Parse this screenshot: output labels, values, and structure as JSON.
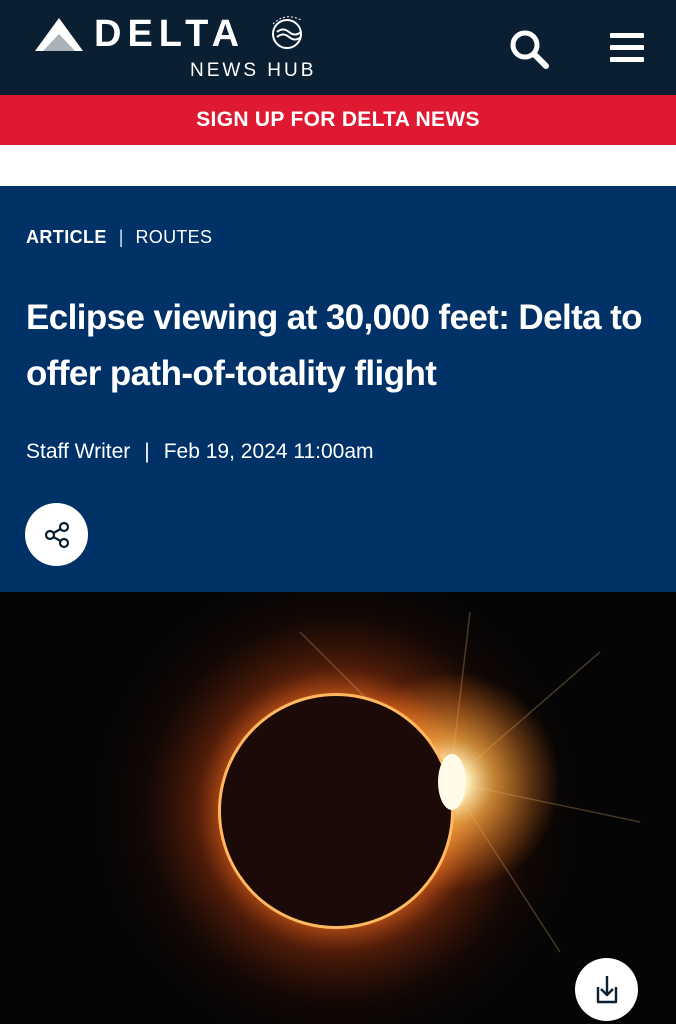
{
  "header": {
    "brand": "DELTA",
    "sub_brand": "NEWS HUB",
    "partner_logo": "SKYTEAM",
    "icons": {
      "search": "search-icon",
      "menu": "hamburger-menu-icon"
    }
  },
  "banner": {
    "label": "SIGN UP FOR DELTA NEWS"
  },
  "article": {
    "category": "ARTICLE",
    "separator": "|",
    "subcategory": "ROUTES",
    "title": "Eclipse viewing at 30,000 feet: Delta to offer path-of-totality flight",
    "author": "Staff Writer",
    "date": "Feb 19, 2024 11:00am"
  },
  "actions": {
    "share_icon": "share-icon",
    "download_icon": "download-icon"
  },
  "colors": {
    "header_bg": "#0b1f33",
    "banner_red": "#e01933",
    "hero_blue": "#003268",
    "white": "#ffffff"
  }
}
